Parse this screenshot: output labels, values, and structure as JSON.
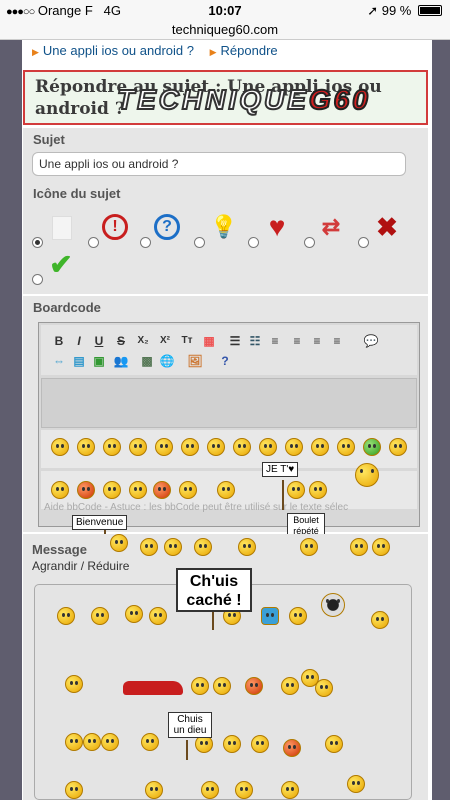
{
  "status_bar": {
    "carrier": "Orange F",
    "network": "4G",
    "time": "10:07",
    "battery": "99 %",
    "battery_level": 0.99
  },
  "browser": {
    "url": "techniqueg60.com"
  },
  "breadcrumb": {
    "link1": "Une appli ios ou android ?",
    "link2": "Répondre"
  },
  "header": {
    "title": "Répondre au sujet : Une appli ios ou android ?",
    "logo_text_a": "TECHNIQUE",
    "logo_text_b": "G60"
  },
  "form": {
    "subject_label": "Sujet",
    "subject_value": "Une appli ios ou android ?",
    "topic_icon_label": "Icône du sujet",
    "topic_icons": [
      "none-icon",
      "exclamation-icon",
      "question-icon",
      "lightbulb-icon",
      "heart-icon",
      "swap-arrows-icon",
      "red-cross-icon",
      "green-check-icon"
    ],
    "boardcode_label": "Boardcode",
    "toolbar": {
      "bold": "B",
      "italic": "I",
      "underline": "U",
      "strike": "S",
      "subscript": "X₂",
      "superscript": "X²",
      "font_size": "Tт"
    },
    "hint": "Aide bbCode - Astuce : les bbCode peut être utilisé sur le texte sélec",
    "message_label": "Message",
    "enlarge_link": "Agrandir /",
    "reduce_link": "Réduire"
  },
  "smiley_signs": {
    "bienvenue": "Bienvenue",
    "je_t_aime": "JE T'♥",
    "boulet": "Boulet répété",
    "chuis_cache": "Ch'uis caché !",
    "chuis_un_dieu": "Chuis un dieu"
  },
  "colors": {
    "link": "#105289",
    "title_border": "#d23b3b",
    "panel": "#e6e6e6",
    "outer_bg": "#5f5d6e"
  }
}
